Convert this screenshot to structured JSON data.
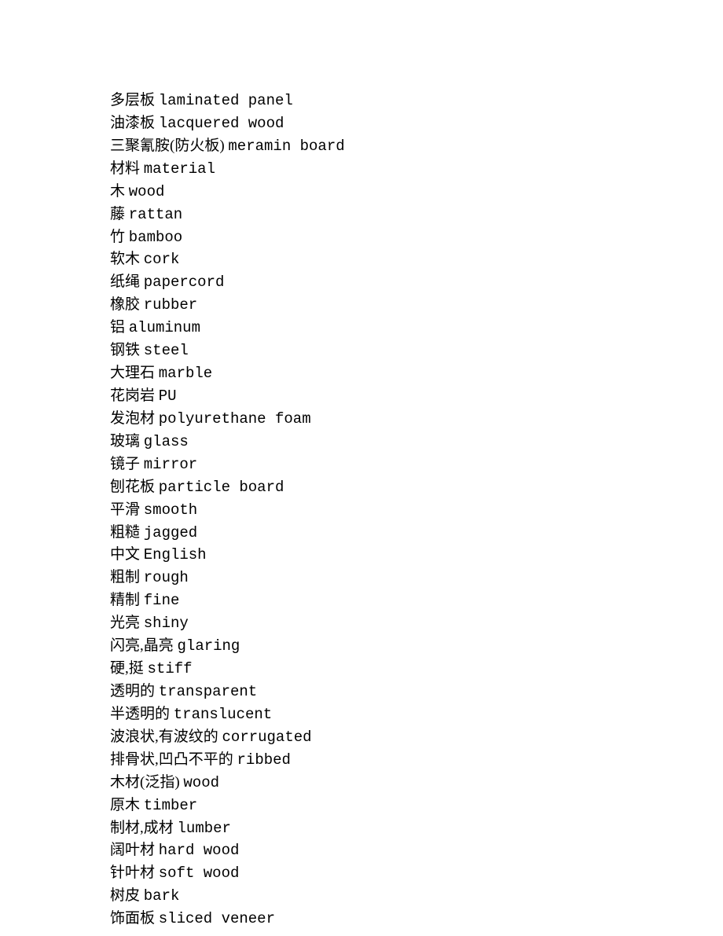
{
  "lines": [
    {
      "cn": "多层板",
      "en": "laminated panel"
    },
    {
      "cn": "油漆板",
      "en": "lacquered wood"
    },
    {
      "cn": "三聚氰胺(防火板)",
      "en": "meramin board"
    },
    {
      "cn": "材料",
      "en": "material"
    },
    {
      "cn": "木",
      "en": "wood"
    },
    {
      "cn": "藤",
      "en": "rattan"
    },
    {
      "cn": "竹",
      "en": "bamboo"
    },
    {
      "cn": "软木",
      "en": "cork"
    },
    {
      "cn": "纸绳",
      "en": "papercord"
    },
    {
      "cn": "橡胶",
      "en": "rubber"
    },
    {
      "cn": "铝",
      "en": "aluminum"
    },
    {
      "cn": "钢铁",
      "en": "steel"
    },
    {
      "cn": "大理石",
      "en": "marble"
    },
    {
      "cn": "花岗岩",
      "en": "PU"
    },
    {
      "cn": "发泡材",
      "en": "polyurethane foam"
    },
    {
      "cn": "玻璃",
      "en": "glass"
    },
    {
      "cn": "镜子",
      "en": "mirror"
    },
    {
      "cn": "刨花板",
      "en": "particle board"
    },
    {
      "cn": "平滑",
      "en": "smooth"
    },
    {
      "cn": "粗糙",
      "en": "jagged"
    },
    {
      "cn": "中文",
      "en": "English"
    },
    {
      "cn": "粗制",
      "en": "rough"
    },
    {
      "cn": "精制",
      "en": "fine"
    },
    {
      "cn": "光亮",
      "en": "shiny"
    },
    {
      "cn": "闪亮,晶亮",
      "en": "glaring"
    },
    {
      "cn": "硬,挺",
      "en": "stiff"
    },
    {
      "cn": "透明的",
      "en": "transparent"
    },
    {
      "cn": "半透明的",
      "en": "translucent"
    },
    {
      "cn": "波浪状,有波纹的",
      "en": "corrugated"
    },
    {
      "cn": "排骨状,凹凸不平的",
      "en": "ribbed"
    },
    {
      "cn": "木材(泛指)",
      "en": "wood"
    },
    {
      "cn": "原木",
      "en": "timber"
    },
    {
      "cn": "制材,成材",
      "en": "lumber"
    },
    {
      "cn": "阔叶材",
      "en": "hard wood"
    },
    {
      "cn": "针叶材",
      "en": "soft wood"
    },
    {
      "cn": "树皮",
      "en": "bark"
    },
    {
      "cn": "饰面板",
      "en": "sliced veneer"
    }
  ]
}
